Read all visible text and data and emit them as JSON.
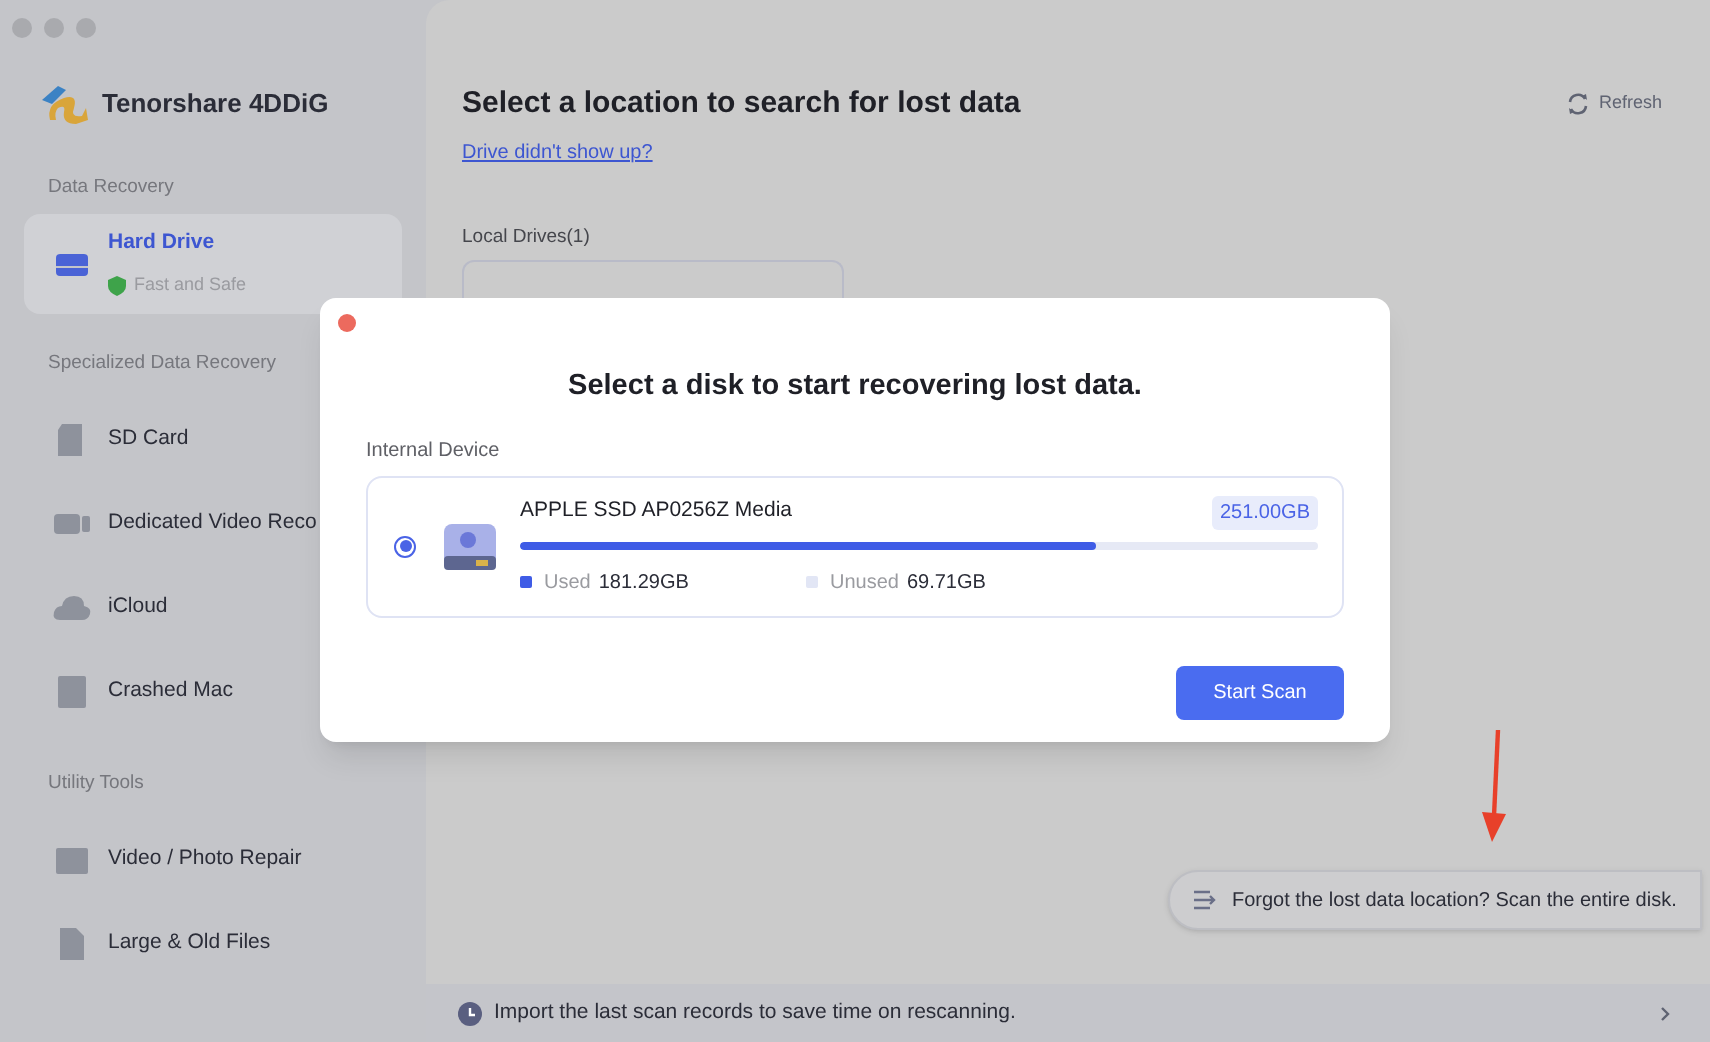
{
  "sidebar": {
    "app_name": "Tenorshare 4DDiG",
    "sections": [
      {
        "heading": "Data Recovery",
        "items": [
          {
            "label": "Hard Drive",
            "subtitle": "Fast and Safe",
            "selected": true
          }
        ]
      },
      {
        "heading": "Specialized Data Recovery",
        "items": [
          {
            "label": "SD Card",
            "selected": false
          },
          {
            "label": "Dedicated Video Reco",
            "selected": false
          },
          {
            "label": "iCloud",
            "selected": false
          },
          {
            "label": "Crashed Mac",
            "selected": false
          }
        ]
      },
      {
        "heading": "Utility Tools",
        "items": [
          {
            "label": "Video / Photo Repair",
            "selected": false
          },
          {
            "label": "Large & Old Files",
            "selected": false
          }
        ]
      }
    ]
  },
  "main": {
    "title": "Select a location to search for lost data",
    "help_link": "Drive didn't show up?",
    "refresh_button": "Refresh",
    "local_drives": {
      "heading": "Local Drives(1)"
    },
    "scan_entire_disk": "Forgot the lost data location? Scan the entire disk.",
    "bottom_bar": "Import the last scan records to save time on rescanning."
  },
  "dialog": {
    "title": "Select a disk to start recovering lost data.",
    "section_label": "Internal Device",
    "disks": [
      {
        "name": "APPLE SSD AP0256Z Media",
        "capacity": "251.00GB",
        "selected": true,
        "level": 0.722,
        "used_label": "Used",
        "used_value": "181.29GB",
        "unused_label": "Unused",
        "unused_value": "69.71GB"
      }
    ],
    "button": "Start Scan"
  }
}
